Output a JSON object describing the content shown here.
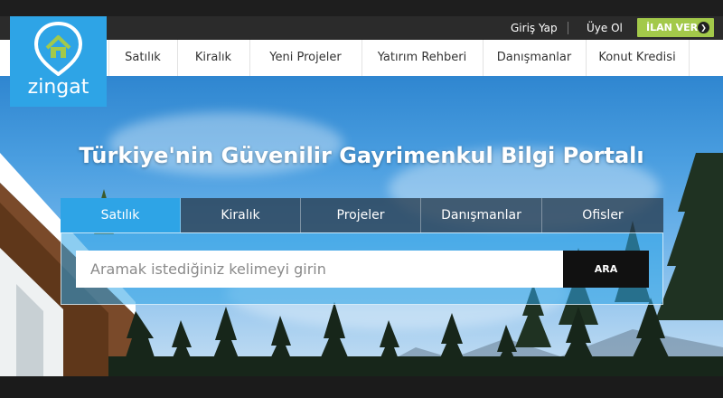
{
  "header": {
    "login_label": "Giriş Yap",
    "register_label": "Üye Ol",
    "post_ad_label": "İLAN VER",
    "post_ad_arrow": "❯"
  },
  "logo": {
    "text": "zingat",
    "color": "#2ea4e6"
  },
  "nav": {
    "items": [
      "Satılık",
      "Kiralık",
      "Yeni Projeler",
      "Yatırım Rehberi",
      "Danışmanlar",
      "Konut Kredisi"
    ]
  },
  "hero": {
    "title": "Türkiye'nin Güvenilir Gayrimenkul Bilgi Portalı"
  },
  "search": {
    "tabs": [
      "Satılık",
      "Kiralık",
      "Projeler",
      "Danışmanlar",
      "Ofisler"
    ],
    "active_tab": 0,
    "placeholder": "Aramak istediğiniz kelimeyi girin",
    "value": "",
    "button_label": "ARA"
  },
  "colors": {
    "accent": "#2ea4e6",
    "ad_button": "#a3c94a",
    "search_button": "#111111"
  }
}
